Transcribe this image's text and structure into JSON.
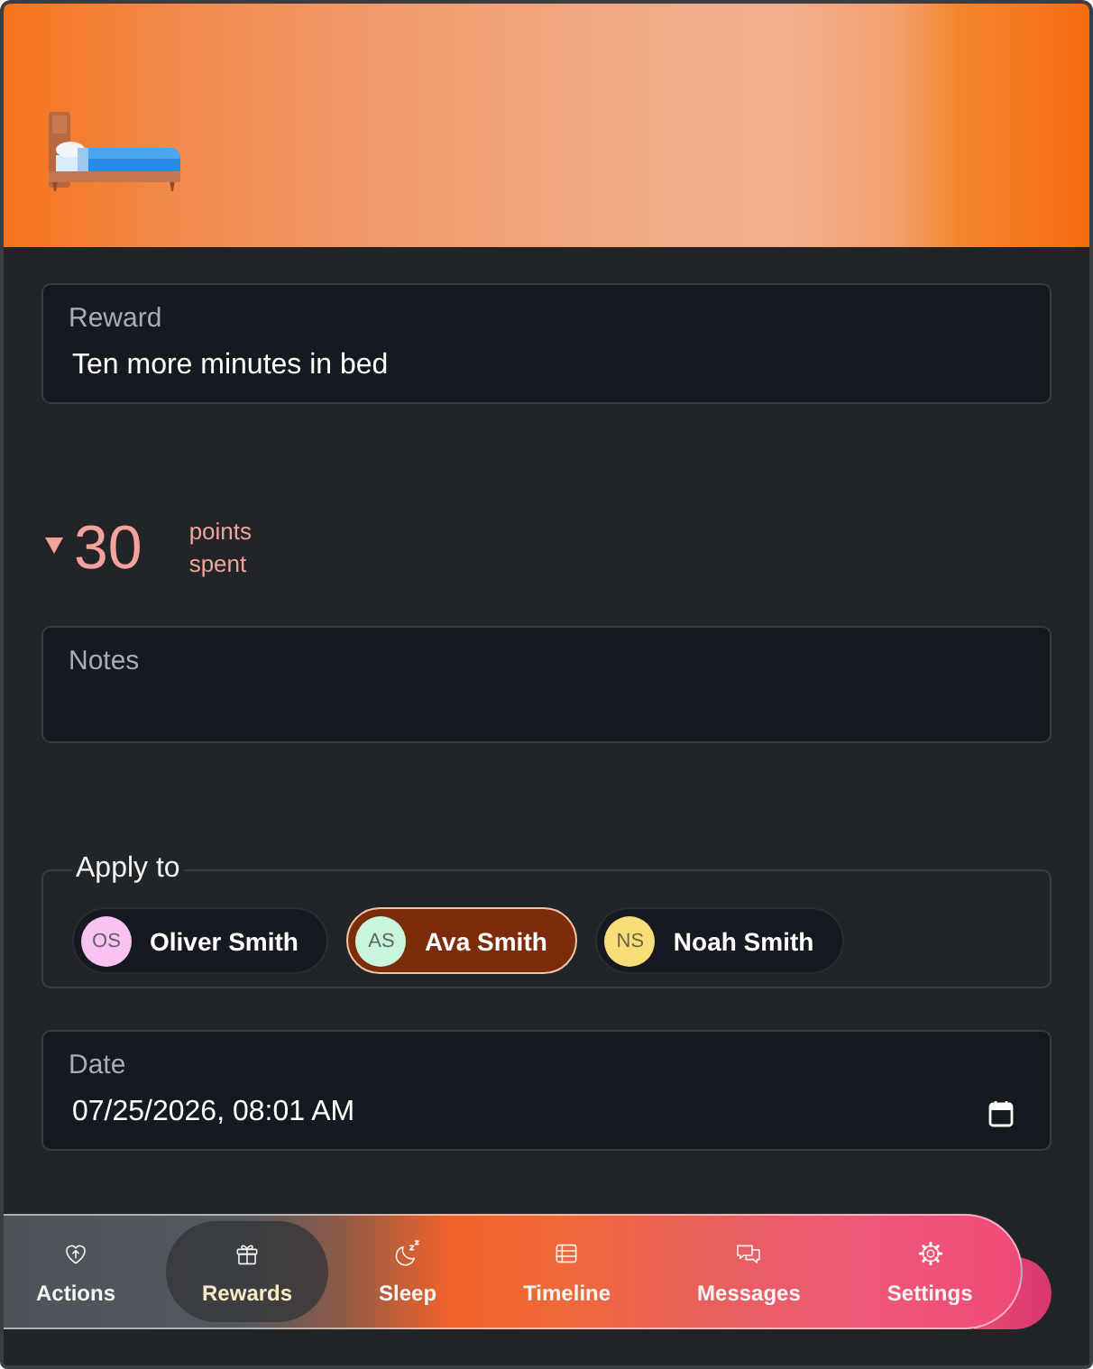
{
  "reward": {
    "label": "Reward",
    "value": "Ten more minutes in bed"
  },
  "points": {
    "spent": true,
    "amount": "30",
    "caption": "points spent"
  },
  "notes": {
    "label": "Notes"
  },
  "apply_to": {
    "label": "Apply to",
    "people": [
      {
        "initials": "OS",
        "name": "Oliver Smith",
        "color": "#f8c3f3",
        "selected": false
      },
      {
        "initials": "AS",
        "name": "Ava Smith",
        "color": "#c8f5de",
        "selected": true
      },
      {
        "initials": "NS",
        "name": "Noah Smith",
        "color": "#f8de78",
        "selected": false
      }
    ]
  },
  "date": {
    "label": "Date",
    "value": "07/25/2026, 08:01 AM"
  },
  "nav": [
    {
      "label": "Actions",
      "selected": false
    },
    {
      "label": "Rewards",
      "selected": true
    },
    {
      "label": "Sleep",
      "selected": false
    },
    {
      "label": "Timeline",
      "selected": false
    },
    {
      "label": "Messages",
      "selected": false
    },
    {
      "label": "Settings",
      "selected": false
    }
  ]
}
